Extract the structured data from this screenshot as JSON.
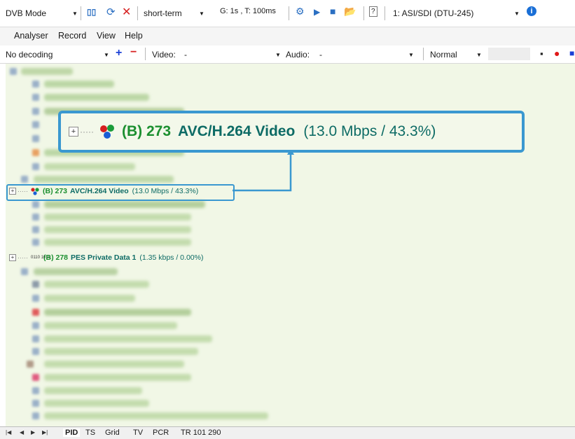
{
  "toolbar1": {
    "mode": "DVB Mode",
    "history": "short-term",
    "timing": "G: 1s , T: 100ms",
    "device": "1: ASI/SDI (DTU-245)"
  },
  "menu": [
    "Analyser",
    "Record",
    "View",
    "Help"
  ],
  "toolbar2": {
    "decoding": "No decoding",
    "video_label": "Video:",
    "video_value": "-",
    "audio_label": "Audio:",
    "audio_value": "-",
    "display": "Normal"
  },
  "tree": {
    "video_pid": {
      "pid": "(B) 273",
      "name": "AVC/H.264 Video",
      "rate": "(13.0 Mbps / 43.3%)"
    },
    "pes_pid": {
      "pid": "(B) 278",
      "name": "PES Private Data 1",
      "rate": "(1.35 kbps / 0.00%)",
      "icon_text": "0110 1010"
    }
  },
  "callout": {
    "pid": "(B) 273",
    "name": "AVC/H.264 Video",
    "rate": "(13.0 Mbps / 43.3%)"
  },
  "tabs": [
    "PID",
    "TS",
    "Grid",
    "TV",
    "PCR",
    "TR 101 290"
  ],
  "colors": {
    "accent": "#3a98d0",
    "pid_green": "#1b8f2f",
    "name_teal": "#0d6b65",
    "tree_bg": "#f1f7e6"
  }
}
